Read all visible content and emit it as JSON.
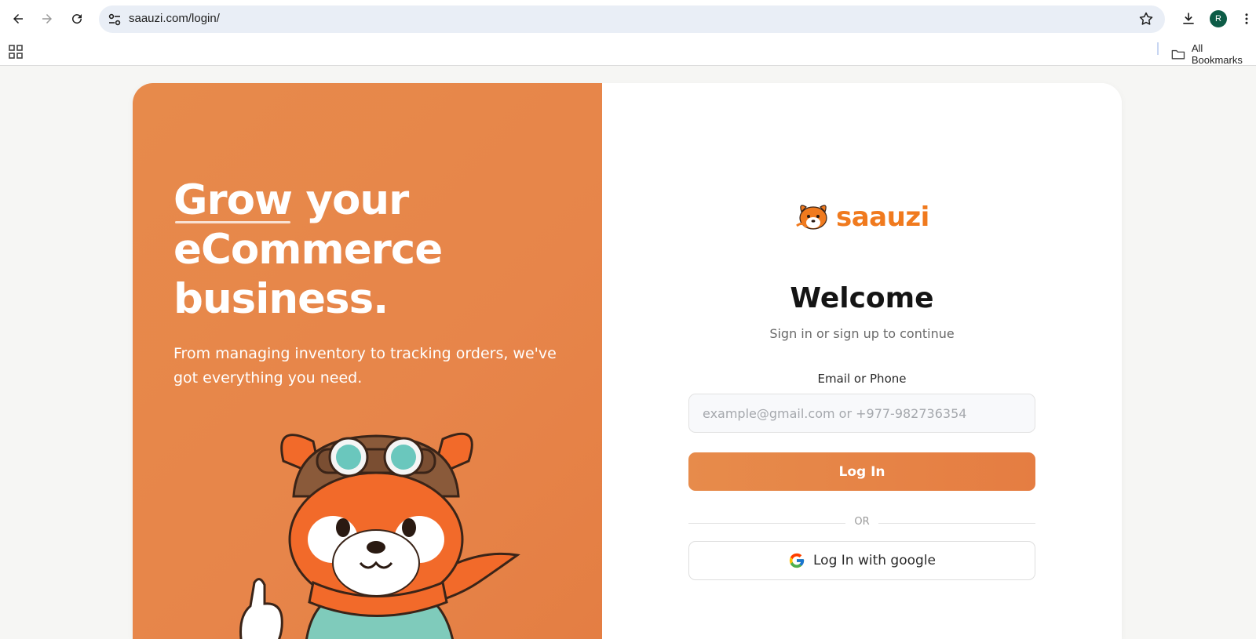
{
  "browser": {
    "url": "saauzi.com/login/",
    "avatar_initial": "R",
    "bookmarks_label": "All Bookmarks"
  },
  "hero": {
    "headline_word_1": "Grow",
    "headline_rest_1": " your",
    "headline_line_2": "eCommerce",
    "headline_line_3": "business.",
    "subtext": "From managing inventory to tracking orders, we've got everything you need."
  },
  "login": {
    "logo_text": "saauzi",
    "title": "Welcome",
    "subtitle": "Sign in or sign up to continue",
    "field_label": "Email or Phone",
    "field_placeholder": "example@gmail.com or +977-982736354",
    "field_value": "",
    "login_button": "Log In",
    "divider_text": "OR",
    "google_button": "Log In with google"
  },
  "colors": {
    "brand_orange": "#e7854a",
    "logo_orange": "#f07a1e",
    "avatar_green": "#0d5c47"
  },
  "icons": [
    "back-arrow-icon",
    "forward-arrow-icon",
    "reload-icon",
    "site-settings-icon",
    "star-icon",
    "download-icon",
    "kebab-menu-icon",
    "apps-grid-icon",
    "folder-icon",
    "google-icon",
    "red-panda-logo-icon"
  ]
}
